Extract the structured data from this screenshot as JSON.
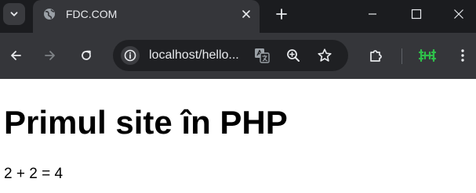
{
  "tab": {
    "title": "FDC.COM"
  },
  "address_bar": {
    "url": "localhost/hello..."
  },
  "page": {
    "heading": "Primul site în PHP",
    "text": "2 + 2 = 4"
  },
  "icons": {
    "tab_menu": "chevron-down-icon",
    "favicon": "globe-icon",
    "tab_close": "close-icon",
    "new_tab": "plus-icon",
    "minimize": "minimize-icon",
    "maximize": "maximize-icon",
    "close_window": "close-icon",
    "back": "arrow-left-icon",
    "forward": "arrow-right-icon",
    "reload": "reload-icon",
    "site_info": "info-icon",
    "translate": "translate-icon",
    "zoom": "zoom-icon",
    "bookmark": "star-icon",
    "extensions": "puzzle-icon",
    "extension": "extension-icon",
    "menu": "more-vertical-icon"
  },
  "colors": {
    "frame": "#202124",
    "toolbar": "#35363a",
    "omnibox": "#1f2023",
    "text_light": "#e8eaed",
    "extension_green": "#2fbf4a"
  }
}
